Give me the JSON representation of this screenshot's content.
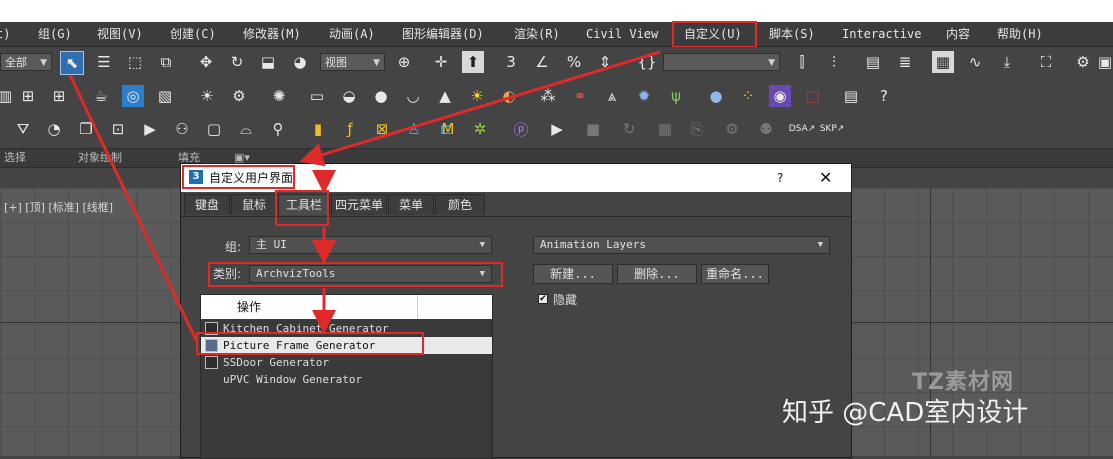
{
  "menubar": {
    "items": [
      "t)",
      "组(G)",
      "视图(V)",
      "创建(C)",
      "修改器(M)",
      "动画(A)",
      "图形编辑器(D)",
      "渲染(R)",
      "Civil View",
      "自定义(U)",
      "脚本(S)",
      "Interactive",
      "内容",
      "帮助(H)"
    ]
  },
  "toolbar": {
    "selection_filter": "全部",
    "reference_coord": "视图"
  },
  "ribbon": {
    "labels": [
      "选择",
      "对象绘制",
      "填充"
    ]
  },
  "viewport": {
    "label": "[+] [顶] [标准] [线框]"
  },
  "dialog": {
    "title": "自定义用户界面",
    "help": "?",
    "close": "✕",
    "tabs": [
      "键盘",
      "鼠标",
      "工具栏",
      "四元菜单",
      "菜单",
      "颜色"
    ],
    "group_label": "组:",
    "group_value": "主 UI",
    "category_label": "类别:",
    "category_value": "ArchvizTools",
    "list_header": "操作",
    "actions": [
      "Kitchen Cabinet Generator",
      "Picture Frame Generator",
      "SSDoor Generator",
      "uPVC Window Generator"
    ],
    "selected_action_index": 1,
    "toolbar_select": "Animation Layers",
    "new_button": "新建...",
    "delete_button": "删除...",
    "rename_button": "重命名...",
    "hide_label": "隐藏",
    "hide_checked": true
  },
  "watermark": {
    "site": "TZ素材网",
    "credit": "知乎 @CAD室内设计"
  },
  "colors": {
    "highlight": "#e02a2a",
    "ui_bg": "#444444",
    "menubar_bg": "#3c3c3c"
  }
}
